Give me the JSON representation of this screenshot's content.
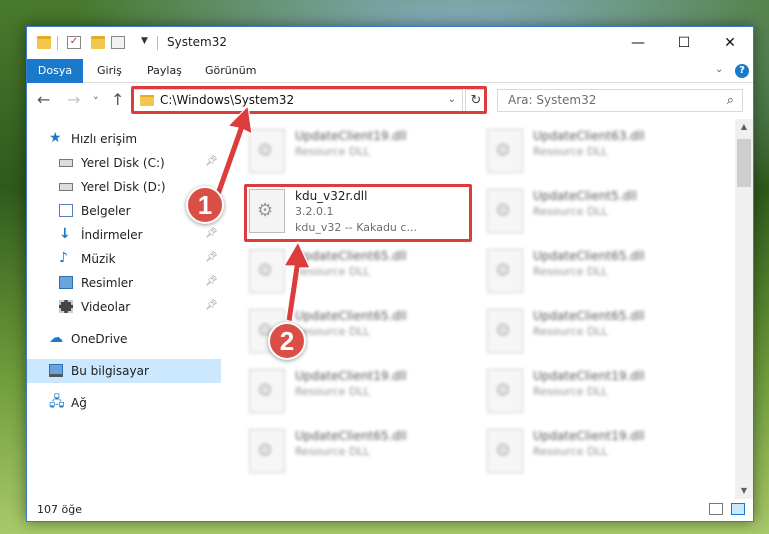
{
  "window": {
    "title": "System32",
    "minimize": "—",
    "maximize": "☐",
    "close": "✕"
  },
  "ribbon": {
    "tabs": [
      "Dosya",
      "Giriş",
      "Paylaş",
      "Görünüm"
    ],
    "active_tab": "Dosya",
    "expand_icon": "chevron-down-icon",
    "help_icon": "help-icon",
    "accent": "#1979ca"
  },
  "navigation": {
    "back": "←",
    "forward": "→",
    "recent": "˅",
    "up": "↑",
    "address_path": "C:\\Windows\\System32",
    "refresh": "↻",
    "search_placeholder": "Ara: System32"
  },
  "sidebar": {
    "items": [
      {
        "label": "Hızlı erişim",
        "icon": "star-icon"
      },
      {
        "label": "Yerel Disk (C:)",
        "icon": "drive-icon",
        "pinned": true
      },
      {
        "label": "Yerel Disk (D:)",
        "icon": "drive-icon"
      },
      {
        "label": "Belgeler",
        "icon": "documents-icon",
        "pinned": true
      },
      {
        "label": "İndirmeler",
        "icon": "downloads-icon",
        "pinned": true
      },
      {
        "label": "Müzik",
        "icon": "music-icon",
        "pinned": true
      },
      {
        "label": "Resimler",
        "icon": "pictures-icon",
        "pinned": true
      },
      {
        "label": "Videolar",
        "icon": "videos-icon",
        "pinned": true
      },
      {
        "label": "OneDrive",
        "icon": "onedrive-icon"
      },
      {
        "label": "Bu bilgisayar",
        "icon": "this-pc-icon",
        "selected": true
      },
      {
        "label": "Ağ",
        "icon": "network-icon"
      }
    ]
  },
  "files": {
    "left_column": [
      {
        "name": "UpdateClient19.dll",
        "desc": "Resource DLL"
      },
      {
        "name": "kdu_v32r.dll",
        "desc": "3.2.0.1",
        "desc2": "kdu_v32 -- Kakadu c...",
        "highlighted": true
      },
      {
        "name": "UpdateClient65.dll",
        "desc": "Resource DLL"
      },
      {
        "name": "UpdateClient65.dll",
        "desc": "Resource DLL"
      },
      {
        "name": "UpdateClient19.dll",
        "desc": "Resource DLL"
      },
      {
        "name": "UpdateClient65.dll",
        "desc": "Resource DLL"
      }
    ],
    "right_column": [
      {
        "name": "UpdateClient63.dll",
        "desc": "Resource DLL"
      },
      {
        "name": "UpdateClient5.dll",
        "desc": "Resource DLL"
      },
      {
        "name": "UpdateClient65.dll",
        "desc": "Resource DLL"
      },
      {
        "name": "UpdateClient65.dll",
        "desc": "Resource DLL"
      },
      {
        "name": "UpdateClient19.dll",
        "desc": "Resource DLL"
      },
      {
        "name": "UpdateClient19.dll",
        "desc": "Resource DLL"
      }
    ]
  },
  "status": {
    "item_count": "107 öğe"
  },
  "annotations": {
    "badge1": "1",
    "badge2": "2",
    "color": "#dc3c3c"
  }
}
